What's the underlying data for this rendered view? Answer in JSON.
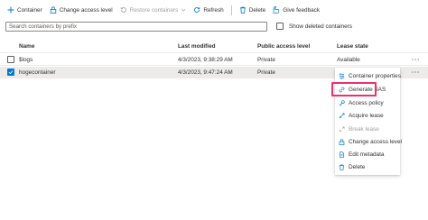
{
  "toolbar": {
    "container_label": "Container",
    "change_access_label": "Change access level",
    "restore_label": "Restore containers",
    "refresh_label": "Refresh",
    "delete_label": "Delete",
    "feedback_label": "Give feedback"
  },
  "search": {
    "placeholder": "Search containers by prefix"
  },
  "show_deleted": {
    "label": "Show deleted containers",
    "checked": false
  },
  "table": {
    "headers": [
      "Name",
      "Last modified",
      "Public access level",
      "Lease state"
    ],
    "rows": [
      {
        "name": "$logs",
        "modified": "4/3/2023, 9:38:29 AM",
        "access": "Private",
        "lease": "Available",
        "checked": false
      },
      {
        "name": "hogecontainer",
        "modified": "4/3/2023, 9:47:24 AM",
        "access": "Private",
        "lease": "",
        "checked": true
      }
    ],
    "more_label": "···"
  },
  "context_menu": {
    "items": [
      {
        "label": "Container properties",
        "icon": "properties-icon",
        "enabled": true
      },
      {
        "label": "Generate SAS",
        "icon": "link-icon",
        "enabled": true,
        "highlighted": true
      },
      {
        "label": "Access policy",
        "icon": "key-icon",
        "enabled": true
      },
      {
        "label": "Acquire lease",
        "icon": "lease-icon",
        "enabled": true
      },
      {
        "label": "Break lease",
        "icon": "break-lease-icon",
        "enabled": false
      },
      {
        "label": "Change access level",
        "icon": "lock-icon",
        "enabled": true
      },
      {
        "label": "Edit metadata",
        "icon": "document-icon",
        "enabled": true
      },
      {
        "label": "Delete",
        "icon": "trash-icon",
        "enabled": true
      }
    ]
  },
  "colors": {
    "accent": "#0078d4",
    "highlight_border": "#e8336d",
    "selected_row": "#edebe9"
  }
}
